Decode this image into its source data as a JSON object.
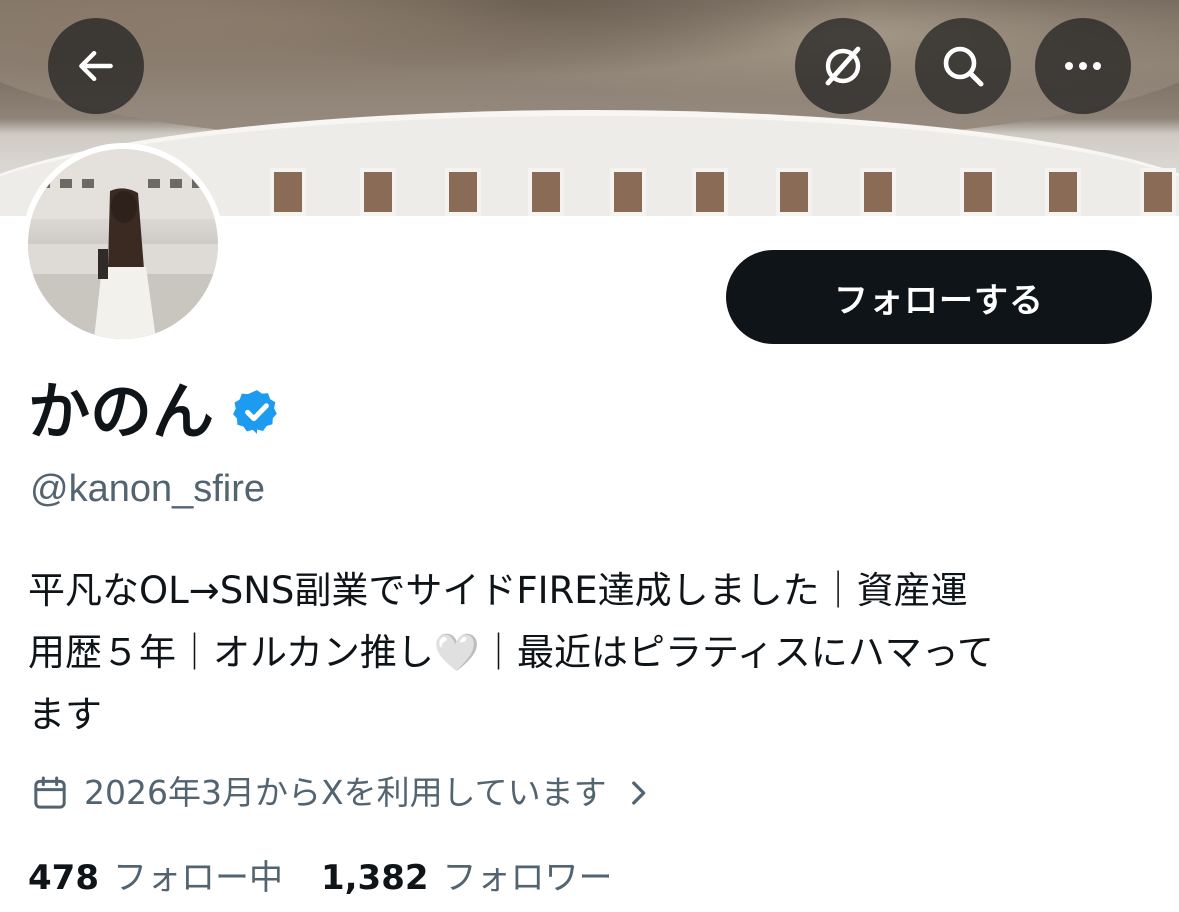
{
  "header": {
    "back_icon": "arrow-left-icon",
    "translate_icon": "slashed-circle-icon",
    "search_icon": "search-icon",
    "more_icon": "more-dots-icon"
  },
  "profile": {
    "display_name": "かのん",
    "verified_icon": "verified-badge-icon",
    "handle": "@kanon_sfire",
    "follow_label": "フォローする",
    "bio_line1": "平凡なOL→SNS副業でサイドFIRE達成しました｜資産運",
    "bio_line2": "用歴５年｜オルカン推し🤍｜最近はピラティスにハマって",
    "bio_line3": "ます",
    "joined": "2026年3月からXを利用しています",
    "following_count": "478",
    "following_label": "フォロー中",
    "followers_count": "1,382",
    "followers_label": "フォロワー"
  },
  "colors": {
    "verified": "#1d9bf0",
    "text_primary": "#0f1419",
    "text_secondary": "#536471",
    "button_bg": "#0f1419"
  }
}
